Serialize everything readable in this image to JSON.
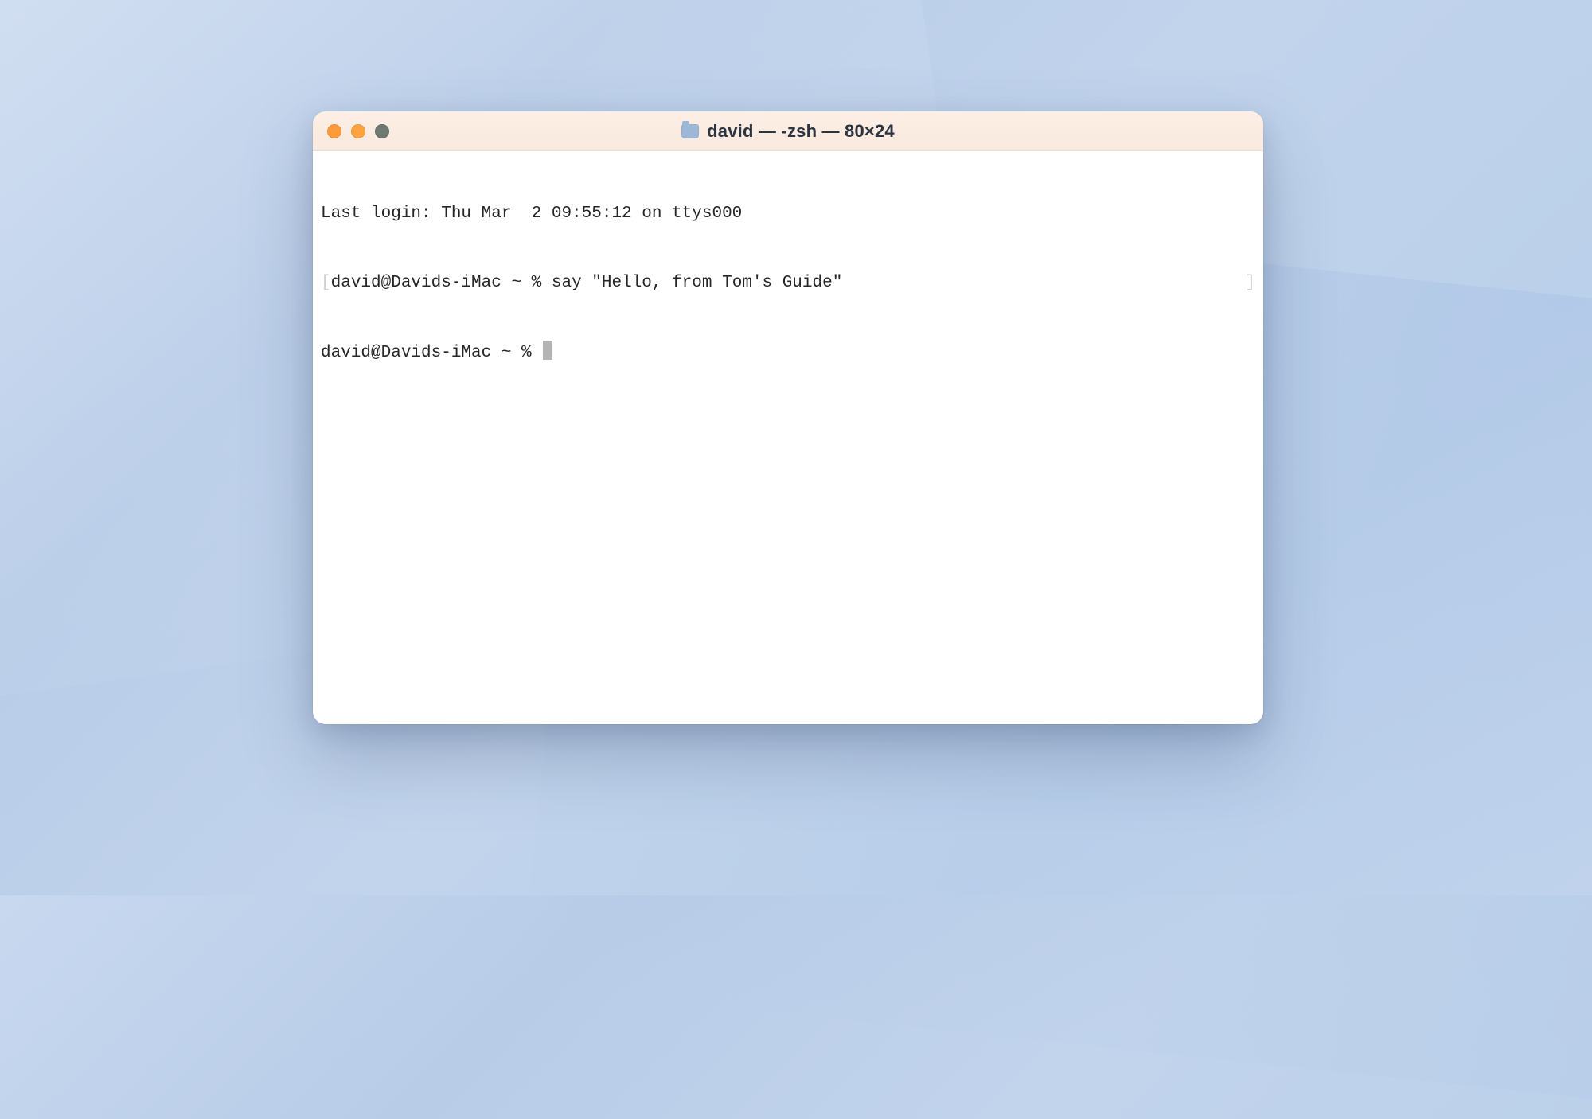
{
  "window": {
    "title": "david — -zsh — 80×24"
  },
  "terminal": {
    "line1": "Last login: Thu Mar  2 09:55:12 on ttys000",
    "line2_bracket_open": "[",
    "line2_prompt": "david@Davids-iMac ~ % ",
    "line2_command": "say \"Hello, from Tom's Guide\"",
    "line2_bracket_close": "]",
    "line3_prompt": "david@Davids-iMac ~ % "
  }
}
